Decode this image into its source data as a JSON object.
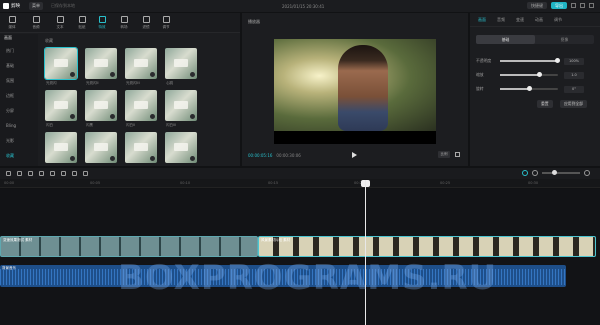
{
  "titlebar": {
    "app_name": "剪映",
    "menu": "菜单",
    "meta": "已保存到本地",
    "project_title": "2021/01/15 20:30:41",
    "buttons": [
      "快捷键",
      "导出"
    ]
  },
  "media": {
    "tools": [
      "媒体",
      "音频",
      "文本",
      "贴纸",
      "特效",
      "转场",
      "滤镜",
      "调节"
    ],
    "active_tool": 4,
    "sidebar_head": "画面",
    "sidebar_items": [
      "热门",
      "基础",
      "氛围",
      "边框",
      "分屏",
      "Bling",
      "光影",
      "收藏"
    ],
    "active_sidebar": 7,
    "grid_label": "收藏",
    "thumbs": [
      "光斑闪",
      "光斑闪II",
      "光斑闪III",
      "心跳",
      "闪白",
      "闪黑",
      "闪白II",
      "闪白III",
      "闪动",
      "闪屏",
      "闪屏II",
      "闪屏III"
    ]
  },
  "player": {
    "title": "播放器",
    "time": "00:00:05:16",
    "duration": "00:00:30:06",
    "ratio": "比例"
  },
  "props": {
    "tabs": [
      "画面",
      "音频",
      "变速",
      "动画",
      "调节"
    ],
    "active_tab": 0,
    "segments": [
      "基础",
      "抠像"
    ],
    "rows": [
      {
        "label": "不透明度",
        "value": "100%",
        "level": 0.98
      },
      {
        "label": "缩放",
        "value": "1.0",
        "level": 0.68
      },
      {
        "label": "旋转",
        "value": "0°",
        "level": 0.5
      }
    ],
    "btn_reset": "重置",
    "btn_apply": "应用到全部"
  },
  "timeline": {
    "ticks": [
      "00:00",
      "00:05",
      "00:10",
      "00:15",
      "00:20",
      "00:25",
      "00:30"
    ],
    "clip1": "变速效果测试 素材",
    "clip2": "风景素材片段 素材",
    "audio": "背景音乐",
    "watermark": "BOXPROGRAMS.RU"
  }
}
